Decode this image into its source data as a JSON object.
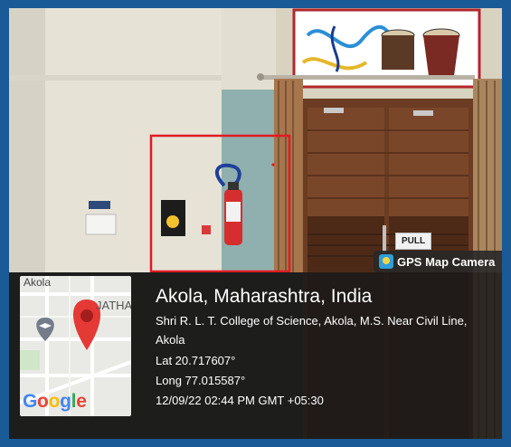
{
  "photo": {
    "description_icons": [
      "fire-extinguisher",
      "wall-sign",
      "switch-board",
      "curtain",
      "wooden-door"
    ],
    "highlight_color": "#e01b24"
  },
  "door_sign": "PULL",
  "gps_badge": {
    "label": "GPS Map Camera",
    "icon": "gps-camera-icon"
  },
  "map": {
    "town_label": "Akola",
    "jatha_label": "JATHA",
    "logo": "Google",
    "pin_color": "#e53935",
    "pin_icon": "location-pin-icon",
    "school_icon": "graduation-cap-icon"
  },
  "location": {
    "title": "Akola, Maharashtra, India",
    "address": "Shri R. L. T. College of Science, Akola, M.S. Near Civil Line, Akola",
    "lat": "Lat 20.717607°",
    "long": "Long 77.015587°",
    "datetime": "12/09/22 02:44 PM GMT +05:30"
  }
}
